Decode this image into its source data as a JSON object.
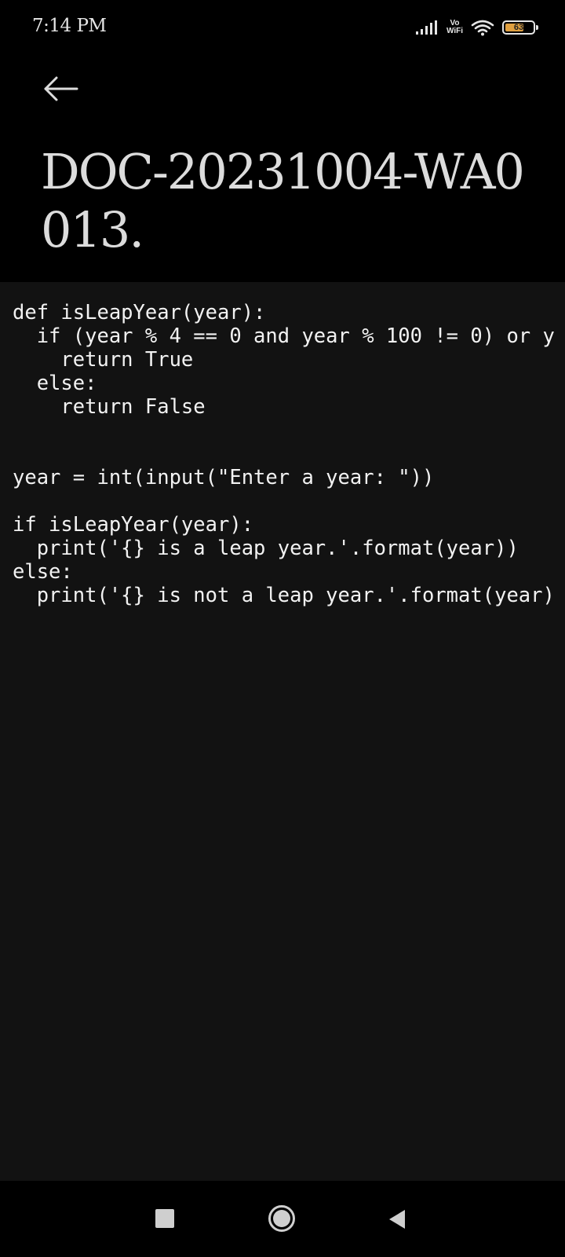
{
  "status_bar": {
    "time": "7:14 PM",
    "vowifi_top": "Vo",
    "vowifi_bottom": "WiFi",
    "battery_level": "63"
  },
  "header": {
    "back_icon": "arrow-left-icon",
    "title": "DOC-20231004-WA0013."
  },
  "document": {
    "code_lines": [
      "def isLeapYear(year):",
      "  if (year % 4 == 0 and year % 100 != 0) or y",
      "    return True",
      "  else:",
      "    return False",
      "",
      "",
      "year = int(input(\"Enter a year: \"))",
      "",
      "if isLeapYear(year):",
      "  print('{} is a leap year.'.format(year))",
      "else:",
      "  print('{} is not a leap year.'.format(year)"
    ]
  },
  "nav_bar": {
    "recents_icon": "square-icon",
    "home_icon": "circle-icon",
    "back_icon": "triangle-back-icon"
  },
  "colors": {
    "background": "#000000",
    "content_background": "#121212",
    "title_color": "#dcdcdc",
    "code_color": "#f2f2f2",
    "battery_fill": "#e0a040"
  }
}
